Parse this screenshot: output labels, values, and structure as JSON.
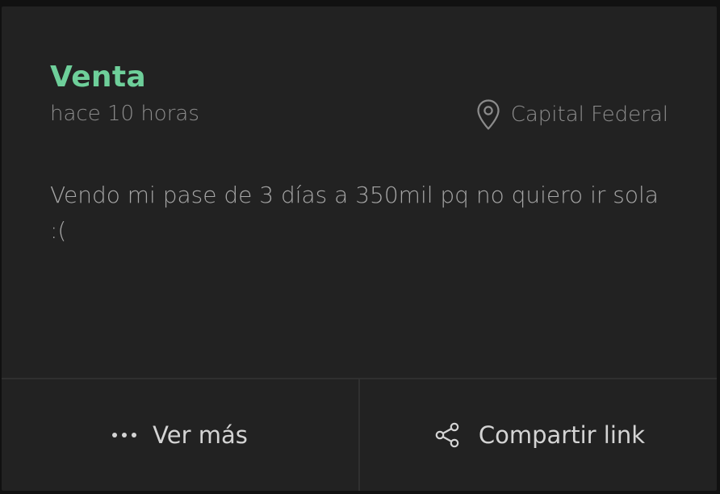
{
  "post": {
    "category": "Venta",
    "time_ago": "hace 10 horas",
    "location": "Capital Federal",
    "description": "Vendo mi pase de 3 días a 350mil pq no quiero ir sola :("
  },
  "actions": {
    "more_label": "Ver más",
    "share_label": "Compartir link"
  },
  "icons": {
    "location": "map-pin-icon",
    "more": "more-dots-icon",
    "share": "share-icon"
  },
  "colors": {
    "background": "#222222",
    "accent": "#6ecf9a",
    "muted_text": "#8c8c8c",
    "body_text": "#a6a6a6",
    "action_text": "#d4d4d4",
    "divider": "#303030"
  }
}
